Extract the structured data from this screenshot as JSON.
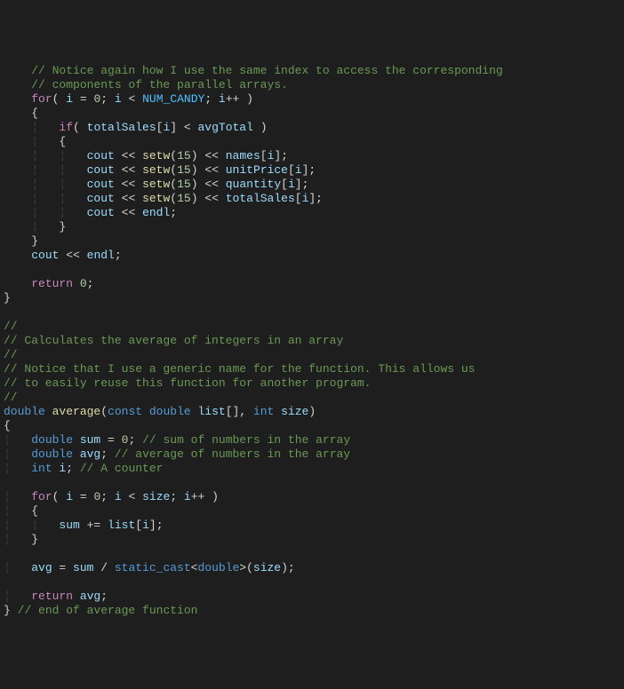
{
  "lines": {
    "l0": "    // Notice again how I use the same index to access the corresponding",
    "l1": "    // components of the parallel arrays.",
    "l2_for": "for",
    "l2_i": "i",
    "l2_eq": " = ",
    "l2_zero": "0",
    "l2_semi1": "; ",
    "l2_i2": "i",
    "l2_lt": " < ",
    "l2_numcandy": "NUM_CANDY",
    "l2_semi2": "; ",
    "l2_i3": "i",
    "l2_pp": "++ )",
    "l3_brace": "{",
    "l4_if": "if",
    "l4_p1": "( ",
    "l4_totalsales": "totalSales",
    "l4_br1": "[",
    "l4_i": "i",
    "l4_br2": "]",
    "l4_lt": " < ",
    "l4_avgtotal": "avgTotal",
    "l4_p2": " )",
    "l5_brace": "{",
    "l6_cout": "cout",
    "l6_ins1": " << ",
    "l6_setw": "setw",
    "l6_p1": "(",
    "l6_15": "15",
    "l6_p2": ")",
    "l6_ins2": " << ",
    "l6_names": "names",
    "l6_br1": "[",
    "l6_i": "i",
    "l6_br2": "];",
    "l7_cout": "cout",
    "l7_ins1": " << ",
    "l7_setw": "setw",
    "l7_p1": "(",
    "l7_15": "15",
    "l7_p2": ")",
    "l7_ins2": " << ",
    "l7_unitprice": "unitPrice",
    "l7_br1": "[",
    "l7_i": "i",
    "l7_br2": "];",
    "l8_cout": "cout",
    "l8_ins1": " << ",
    "l8_setw": "setw",
    "l8_p1": "(",
    "l8_15": "15",
    "l8_p2": ")",
    "l8_ins2": " << ",
    "l8_quantity": "quantity",
    "l8_br1": "[",
    "l8_i": "i",
    "l8_br2": "];",
    "l9_cout": "cout",
    "l9_ins1": " << ",
    "l9_setw": "setw",
    "l9_p1": "(",
    "l9_15": "15",
    "l9_p2": ")",
    "l9_ins2": " << ",
    "l9_totalsales": "totalSales",
    "l9_br1": "[",
    "l9_i": "i",
    "l9_br2": "];",
    "l10_cout": "cout",
    "l10_ins": " << ",
    "l10_endl": "endl",
    "l10_semi": ";",
    "l11_brace": "}",
    "l12_brace": "}",
    "l13_cout": "cout",
    "l13_ins": " << ",
    "l13_endl": "endl",
    "l13_semi": ";",
    "l14_return": "return",
    "l14_zero": " 0",
    "l14_semi": ";",
    "l15_brace": "}",
    "l16": "//",
    "l17": "// Calculates the average of integers in an array",
    "l18": "//",
    "l19": "// Notice that I use a generic name for the function. This allows us",
    "l20": "// to easily reuse this function for another program.",
    "l21": "//",
    "l22_double": "double",
    "l22_average": " average",
    "l22_p1": "(",
    "l22_const": "const",
    "l22_double2": " double",
    "l22_list": " list",
    "l22_br": "[], ",
    "l22_int": "int",
    "l22_size": " size",
    "l22_p2": ")",
    "l23_brace": "{",
    "l24_double": "double",
    "l24_sum": " sum",
    "l24_eq": " = ",
    "l24_zero": "0",
    "l24_semi": "; ",
    "l24_comment": "// sum of numbers in the array",
    "l25_double": "double",
    "l25_avg": " avg",
    "l25_semi": "; ",
    "l25_comment": "// average of numbers in the array",
    "l26_int": "int",
    "l26_i": " i",
    "l26_semi": "; ",
    "l26_comment": "// A counter",
    "l27_for": "for",
    "l27_p1": "( ",
    "l27_i": "i",
    "l27_eq": " = ",
    "l27_zero": "0",
    "l27_semi1": "; ",
    "l27_i2": "i",
    "l27_lt": " < ",
    "l27_size": "size",
    "l27_semi2": "; ",
    "l27_i3": "i",
    "l27_pp": "++ )",
    "l28_brace": "{",
    "l29_sum": "sum",
    "l29_pe": " += ",
    "l29_list": "list",
    "l29_br1": "[",
    "l29_i": "i",
    "l29_br2": "];",
    "l30_brace": "}",
    "l31_avg": "avg",
    "l31_eq": " = ",
    "l31_sum": "sum",
    "l31_div": " / ",
    "l31_static": "static_cast",
    "l31_lt": "<",
    "l31_double": "double",
    "l31_gt": ">(",
    "l31_size": "size",
    "l31_p2": ");",
    "l32_return": "return",
    "l32_avg": " avg",
    "l32_semi": ";",
    "l33_brace": "}",
    "l33_comment": " // end of average function"
  }
}
